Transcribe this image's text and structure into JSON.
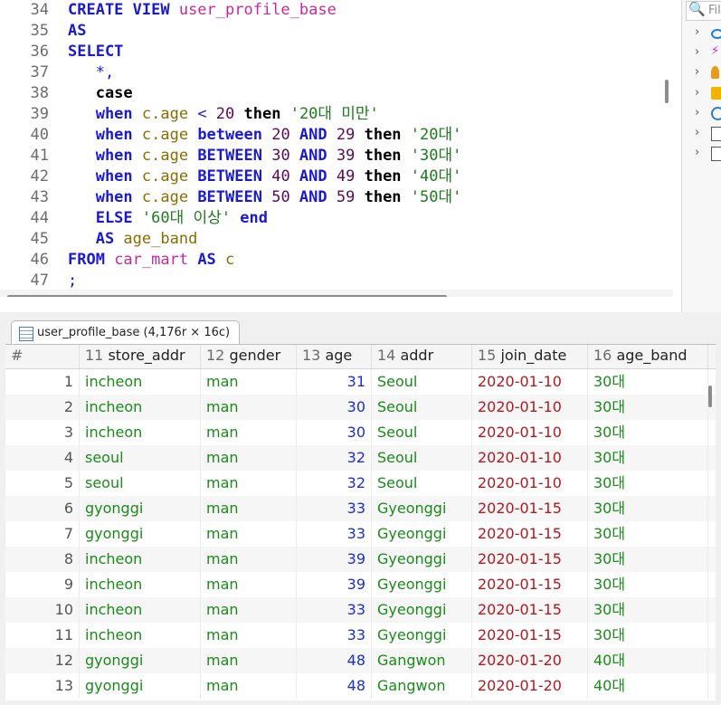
{
  "editor": {
    "lines": [
      {
        "n": "34",
        "tokens": [
          [
            "kw",
            "CREATE VIEW "
          ],
          [
            "tbl",
            "user_profile_base"
          ]
        ]
      },
      {
        "n": "35",
        "tokens": [
          [
            "kw",
            "AS"
          ]
        ]
      },
      {
        "n": "36",
        "tokens": [
          [
            "kw",
            "SELECT"
          ]
        ]
      },
      {
        "n": "37",
        "tokens": [
          [
            "plain",
            "   *,"
          ]
        ]
      },
      {
        "n": "38",
        "tokens": [
          [
            "kw2",
            "   case"
          ]
        ]
      },
      {
        "n": "39",
        "tokens": [
          [
            "kw",
            "   when "
          ],
          [
            "col",
            "c.age"
          ],
          [
            "plain",
            " < "
          ],
          [
            "num",
            "20"
          ],
          [
            "kw2",
            " then "
          ],
          [
            "str",
            "'20대 미만'"
          ]
        ]
      },
      {
        "n": "40",
        "tokens": [
          [
            "kw",
            "   when "
          ],
          [
            "col",
            "c.age"
          ],
          [
            "kw",
            " between "
          ],
          [
            "num",
            "20"
          ],
          [
            "kw",
            " AND "
          ],
          [
            "num",
            "29"
          ],
          [
            "kw2",
            " then "
          ],
          [
            "str",
            "'20대'"
          ]
        ]
      },
      {
        "n": "41",
        "tokens": [
          [
            "kw",
            "   when "
          ],
          [
            "col",
            "c.age"
          ],
          [
            "kw",
            " BETWEEN "
          ],
          [
            "num",
            "30"
          ],
          [
            "kw",
            " AND "
          ],
          [
            "num",
            "39"
          ],
          [
            "kw2",
            " then "
          ],
          [
            "str",
            "'30대'"
          ]
        ]
      },
      {
        "n": "42",
        "tokens": [
          [
            "kw",
            "   when "
          ],
          [
            "col",
            "c.age"
          ],
          [
            "kw",
            " BETWEEN "
          ],
          [
            "num",
            "40"
          ],
          [
            "kw",
            " AND "
          ],
          [
            "num",
            "49"
          ],
          [
            "kw2",
            " then "
          ],
          [
            "str",
            "'40대'"
          ]
        ]
      },
      {
        "n": "43",
        "tokens": [
          [
            "kw",
            "   when "
          ],
          [
            "col",
            "c.age"
          ],
          [
            "kw",
            " BETWEEN "
          ],
          [
            "num",
            "50"
          ],
          [
            "kw",
            " AND "
          ],
          [
            "num",
            "59"
          ],
          [
            "kw2",
            " then "
          ],
          [
            "str",
            "'50대'"
          ]
        ]
      },
      {
        "n": "44",
        "tokens": [
          [
            "kw",
            "   ELSE "
          ],
          [
            "str",
            "'60대 이상'"
          ],
          [
            "kw",
            " end"
          ]
        ]
      },
      {
        "n": "45",
        "tokens": [
          [
            "kw",
            "   AS "
          ],
          [
            "col",
            "age_band"
          ]
        ]
      },
      {
        "n": "46",
        "tokens": [
          [
            "kw",
            "FROM "
          ],
          [
            "tbl",
            "car_mart"
          ],
          [
            "kw",
            " AS "
          ],
          [
            "col",
            "c"
          ]
        ]
      },
      {
        "n": "47",
        "tokens": [
          [
            "plain",
            ";"
          ]
        ]
      }
    ]
  },
  "navigator": {
    "filter_placeholder": "Fil",
    "filter_icon": "search-icon",
    "rows": [
      {
        "icon": "eye-icon",
        "color": "#1a7fd8"
      },
      {
        "icon": "lightning-icon",
        "color": "#d81ad8"
      },
      {
        "icon": "key-icon",
        "color": "#e89a1a"
      },
      {
        "icon": "folder-icon",
        "color": "#f0b400"
      },
      {
        "icon": "clock-icon",
        "color": "#2a7fc0"
      },
      {
        "icon": "checkbox-icon",
        "color": "#555555"
      },
      {
        "icon": "checkbox-icon",
        "color": "#555555"
      }
    ]
  },
  "result_tab": {
    "label": "user_profile_base (4,176r × 16c)",
    "icon": "table-grid-icon"
  },
  "grid": {
    "columns": [
      {
        "idx": "#",
        "name": ""
      },
      {
        "idx": "11",
        "name": "store_addr"
      },
      {
        "idx": "12",
        "name": "gender"
      },
      {
        "idx": "13",
        "name": "age"
      },
      {
        "idx": "14",
        "name": "addr"
      },
      {
        "idx": "15",
        "name": "join_date"
      },
      {
        "idx": "16",
        "name": "age_band"
      }
    ],
    "rows": [
      [
        "1",
        "incheon",
        "man",
        "31",
        "Seoul",
        "2020-01-10",
        "30대"
      ],
      [
        "2",
        "incheon",
        "man",
        "30",
        "Seoul",
        "2020-01-10",
        "30대"
      ],
      [
        "3",
        "incheon",
        "man",
        "30",
        "Seoul",
        "2020-01-10",
        "30대"
      ],
      [
        "4",
        "seoul",
        "man",
        "32",
        "Seoul",
        "2020-01-10",
        "30대"
      ],
      [
        "5",
        "seoul",
        "man",
        "32",
        "Seoul",
        "2020-01-10",
        "30대"
      ],
      [
        "6",
        "gyonggi",
        "man",
        "33",
        "Gyeonggi",
        "2020-01-15",
        "30대"
      ],
      [
        "7",
        "gyonggi",
        "man",
        "33",
        "Gyeonggi",
        "2020-01-15",
        "30대"
      ],
      [
        "8",
        "incheon",
        "man",
        "39",
        "Gyeonggi",
        "2020-01-15",
        "30대"
      ],
      [
        "9",
        "incheon",
        "man",
        "39",
        "Gyeonggi",
        "2020-01-15",
        "30대"
      ],
      [
        "10",
        "incheon",
        "man",
        "33",
        "Gyeonggi",
        "2020-01-15",
        "30대"
      ],
      [
        "11",
        "incheon",
        "man",
        "33",
        "Gyeonggi",
        "2020-01-15",
        "30대"
      ],
      [
        "12",
        "gyonggi",
        "man",
        "48",
        "Gangwon",
        "2020-01-20",
        "40대"
      ],
      [
        "13",
        "gyonggi",
        "man",
        "48",
        "Gangwon",
        "2020-01-20",
        "40대"
      ]
    ]
  }
}
